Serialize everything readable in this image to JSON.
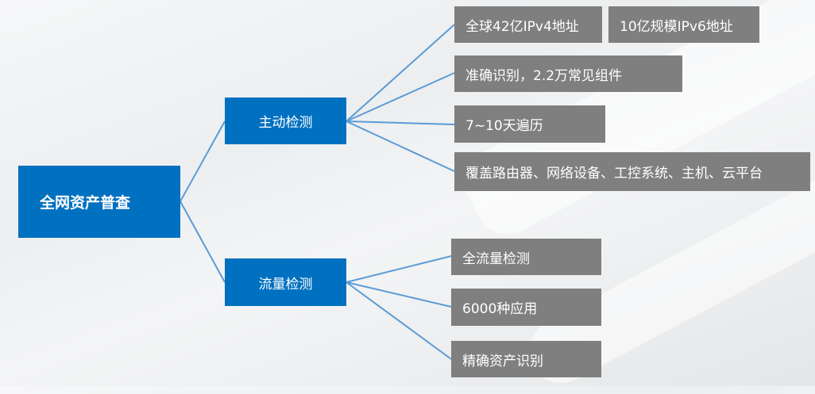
{
  "diagram": {
    "root": {
      "label": "全网资产普查"
    },
    "branches": [
      {
        "label": "主动检测",
        "leaves": [
          "全球42亿IPv4地址",
          "10亿规模IPv6地址",
          "准确识别，2.2万常见组件",
          "7~10天遍历",
          "覆盖路由器、网络设备、工控系统、主机、云平台"
        ]
      },
      {
        "label": "流量检测",
        "leaves": [
          "全流量检测",
          "6000种应用",
          "精确资产识别"
        ]
      }
    ]
  }
}
